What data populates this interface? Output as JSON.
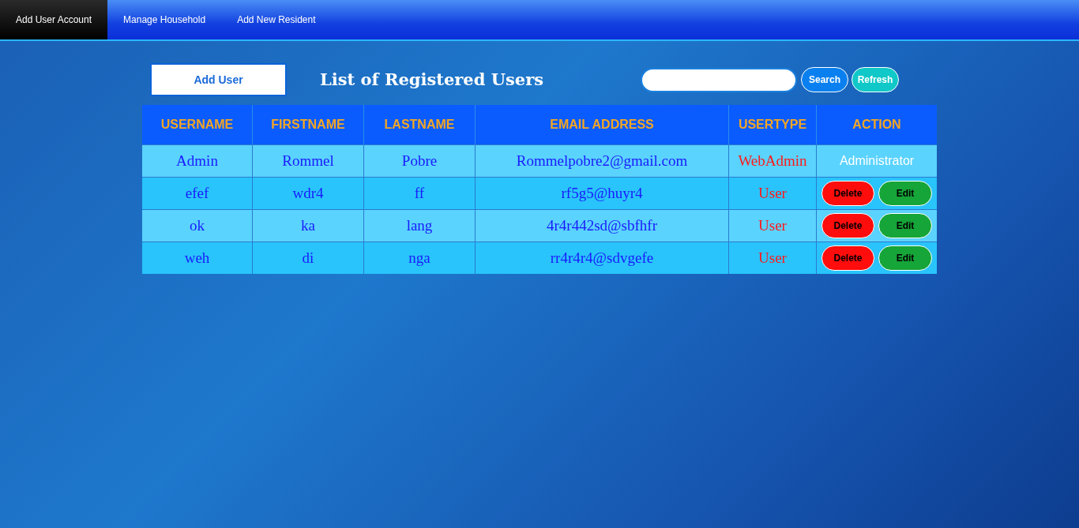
{
  "nav": {
    "tabs": [
      {
        "label": "Add User Account",
        "selected": true
      },
      {
        "label": "Manage Household",
        "selected": false
      },
      {
        "label": "Add New Resident",
        "selected": false
      }
    ]
  },
  "toolbar": {
    "add_button": "Add User",
    "title": "List of Registered Users",
    "search_button": "Search",
    "refresh_button": "Refresh"
  },
  "table": {
    "columns": [
      "USERNAME",
      "FIRSTNAME",
      "LASTNAME",
      "EMAIL ADDRESS",
      "USERTYPE",
      "ACTION"
    ],
    "rows": [
      {
        "username": "Admin",
        "firstname": "Rommel",
        "lastname": "Pobre",
        "email": "Rommelpobre2@gmail.com",
        "usertype": "WebAdmin",
        "action": {
          "kind": "text",
          "text": "Administrator"
        }
      },
      {
        "username": "efef",
        "firstname": "wdr4",
        "lastname": "ff",
        "email": "rf5g5@huyr4",
        "usertype": "User",
        "action": {
          "kind": "buttons",
          "delete": "Delete",
          "edit": "Edit"
        }
      },
      {
        "username": "ok",
        "firstname": "ka",
        "lastname": "lang",
        "email": "4r4r442sd@sbfhfr",
        "usertype": "User",
        "action": {
          "kind": "buttons",
          "delete": "Delete",
          "edit": "Edit"
        }
      },
      {
        "username": "weh",
        "firstname": "di",
        "lastname": "nga",
        "email": "rr4r4r4@sdvgefe",
        "usertype": "User",
        "action": {
          "kind": "buttons",
          "delete": "Delete",
          "edit": "Edit"
        }
      }
    ]
  }
}
